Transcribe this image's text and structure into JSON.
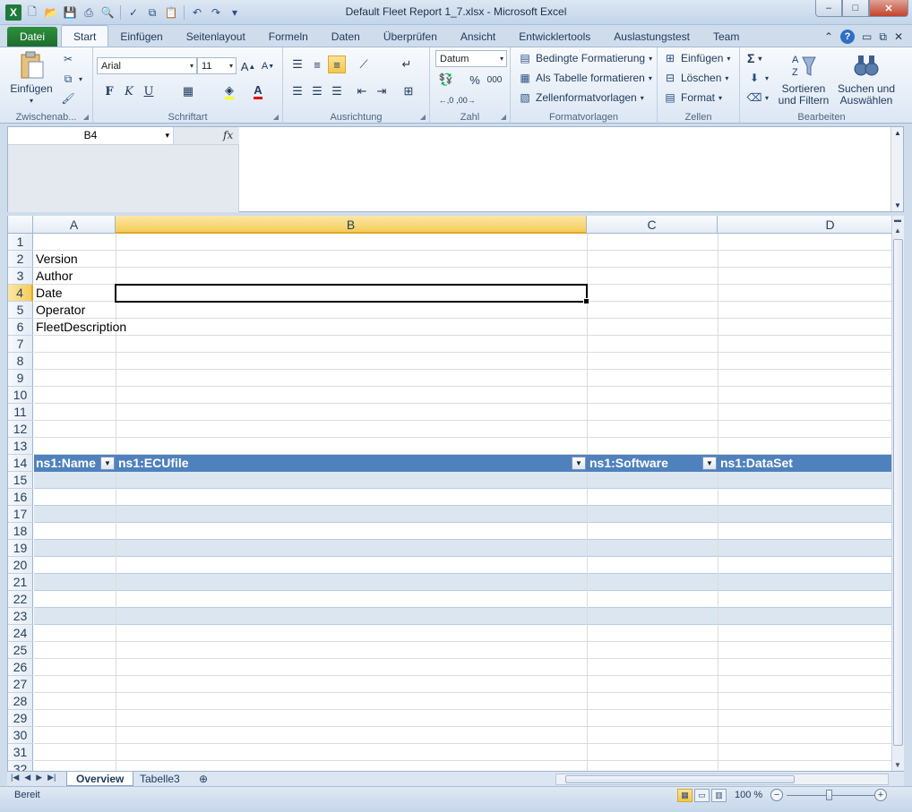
{
  "window": {
    "title": "Default Fleet Report 1_7.xlsx  -  Microsoft Excel",
    "controls": {
      "minimize": "–",
      "maximize": "□",
      "close": "✕"
    }
  },
  "ribbon": {
    "tabs": [
      "Datei",
      "Start",
      "Einfügen",
      "Seitenlayout",
      "Formeln",
      "Daten",
      "Überprüfen",
      "Ansicht",
      "Entwicklertools",
      "Auslastungstest",
      "Team"
    ],
    "active_tab": "Start",
    "clipboard": {
      "paste": "Einfügen",
      "label": "Zwischenab..."
    },
    "font": {
      "name": "Arial",
      "size": "11",
      "label": "Schriftart",
      "bold": "F",
      "italic": "K",
      "underline": "U"
    },
    "alignment": {
      "label": "Ausrichtung"
    },
    "number": {
      "format": "Datum",
      "label": "Zahl",
      "percent": "%",
      "thousands": "000"
    },
    "styles": {
      "conditional": "Bedingte Formatierung",
      "as_table": "Als Tabelle formatieren",
      "cell_styles": "Zellenformatvorlagen",
      "label": "Formatvorlagen"
    },
    "cells": {
      "insert": "Einfügen",
      "delete": "Löschen",
      "format": "Format",
      "label": "Zellen"
    },
    "editing": {
      "sum": "Σ",
      "sort_line1": "Sortieren",
      "sort_line2": "und Filtern",
      "find_line1": "Suchen und",
      "find_line2": "Auswählen",
      "label": "Bearbeiten"
    }
  },
  "formula_bar": {
    "name_box": "B4",
    "fx": "fx",
    "value": ""
  },
  "grid": {
    "columns": [
      "A",
      "B",
      "C",
      "D"
    ],
    "selected_column": "B",
    "selected_row": "4",
    "rows": [
      "1",
      "2",
      "3",
      "4",
      "5",
      "6",
      "7",
      "8",
      "9",
      "10",
      "11",
      "12",
      "13",
      "14",
      "15",
      "16",
      "17",
      "18",
      "19",
      "20",
      "21",
      "22",
      "23",
      "24",
      "25",
      "26",
      "27",
      "28",
      "29",
      "30",
      "31",
      "32"
    ],
    "cells": {
      "A2": "Version",
      "A3": "Author",
      "A4": "Date",
      "A5": "Operator",
      "A6": "FleetDescription"
    },
    "table_headers": [
      "ns1:Name",
      "ns1:ECUfile",
      "ns1:Software",
      "ns1:DataSet"
    ]
  },
  "sheets": {
    "tabs": [
      "Overview",
      "Tabelle3"
    ],
    "active": "Overview"
  },
  "status": {
    "text": "Bereit",
    "zoom": "100 %"
  }
}
